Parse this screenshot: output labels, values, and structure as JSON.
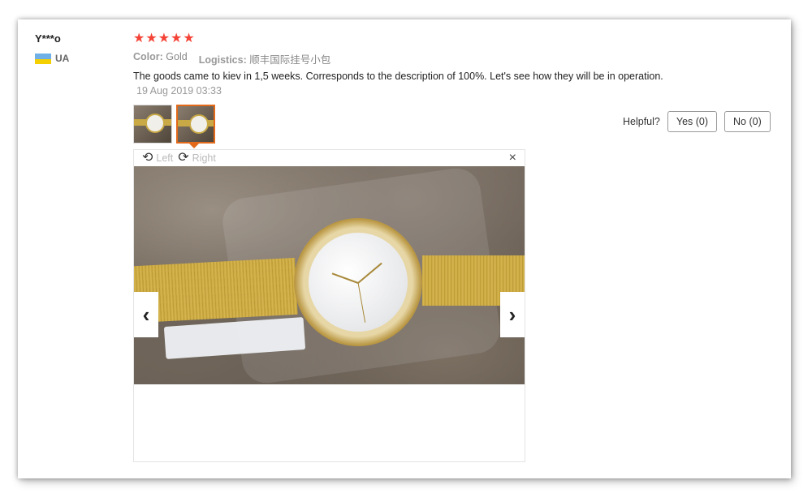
{
  "review": {
    "user_name": "Y***o",
    "country_code": "UA",
    "rating": 5,
    "stars": [
      "★",
      "★",
      "★",
      "★",
      "★"
    ],
    "color_label": "Color:",
    "color_value": "Gold",
    "logistics_label": "Logistics:",
    "logistics_value": "顺丰国际挂号小包",
    "text": "The goods came to kiev in 1,5 weeks. Corresponds to the description of 100%. Let's see how they will be in operation.",
    "date": "19 Aug 2019 03:33",
    "helpful_label": "Helpful?",
    "yes_label": "Yes (0)",
    "no_label": "No (0)"
  },
  "viewer": {
    "rotate_left_label": "Left",
    "rotate_right_label": "Right",
    "close_icon": "×",
    "prev_icon": "‹",
    "next_icon": "›"
  },
  "colors": {
    "star": "#f44336",
    "active_thumb_border": "#e26a1a",
    "flag_blue": "#6fb1e6",
    "flag_yellow": "#f5d000"
  }
}
